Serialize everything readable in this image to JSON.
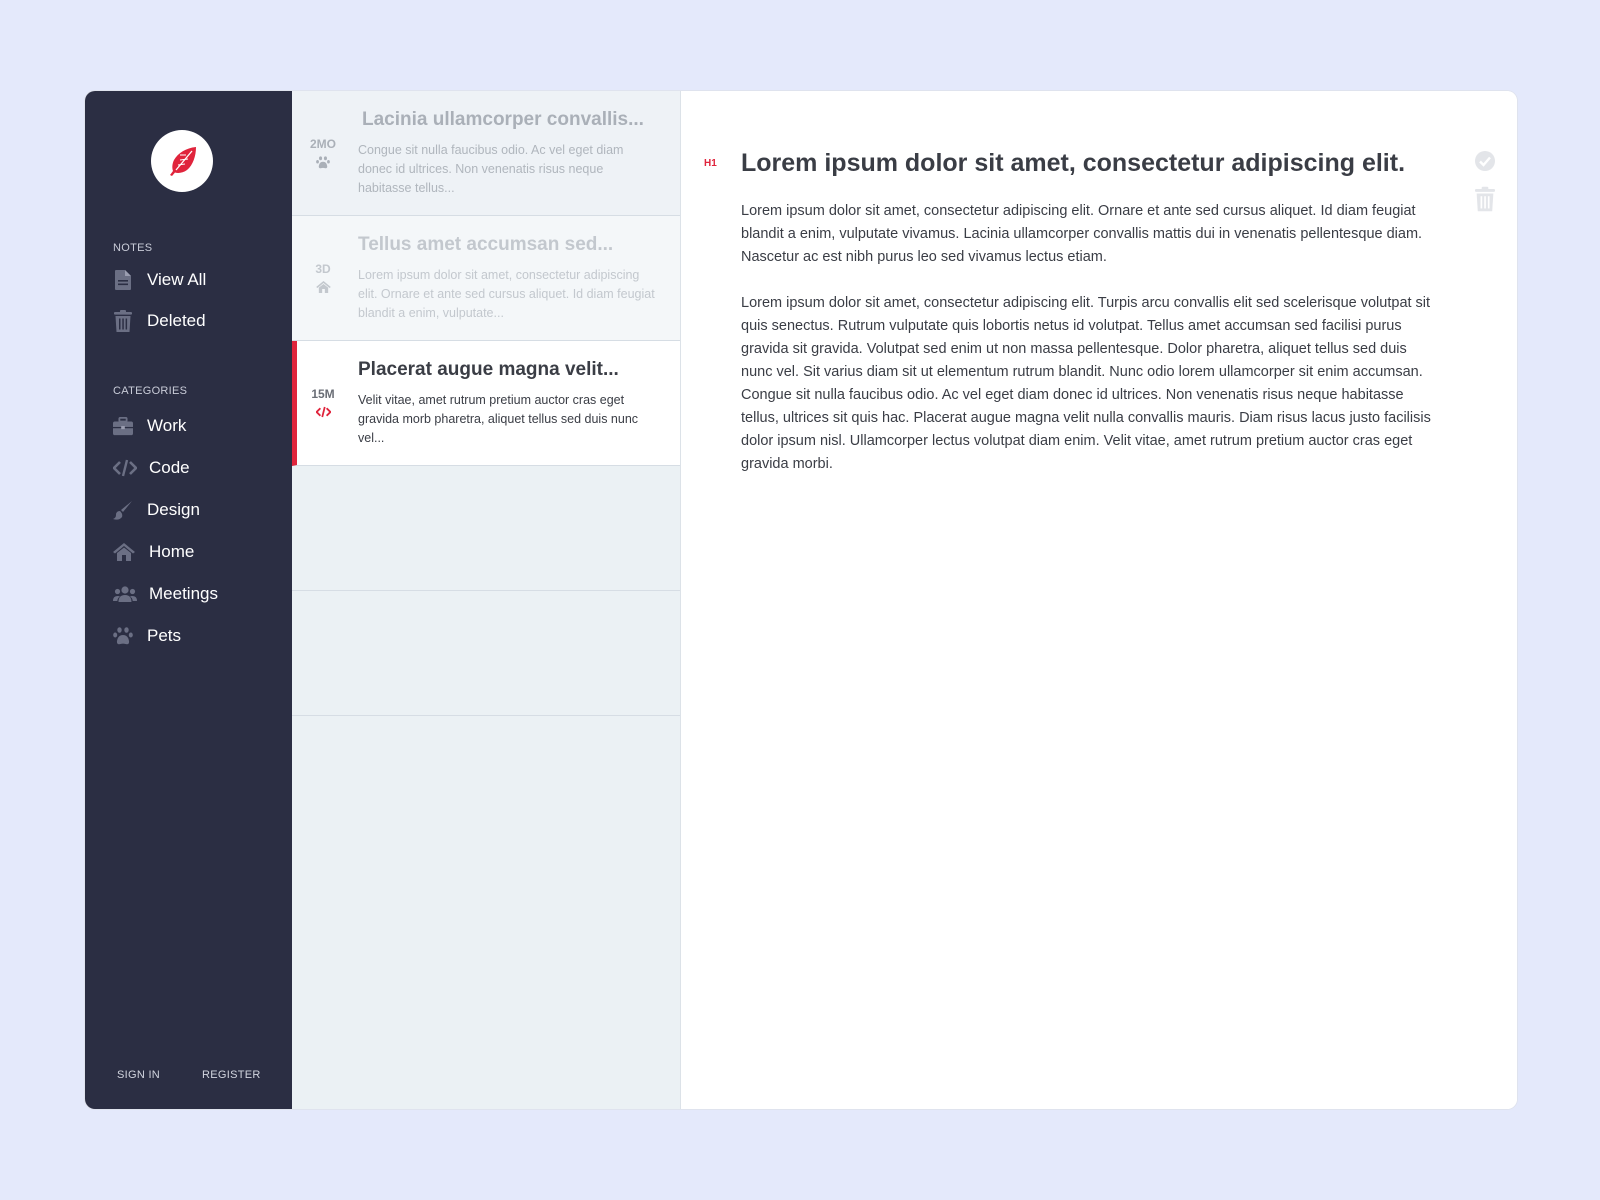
{
  "sidebar": {
    "logo_icon": "feather-icon",
    "notes_label": "NOTES",
    "notes_items": [
      {
        "label": "View All",
        "icon": "file-icon"
      },
      {
        "label": "Deleted",
        "icon": "trash-icon"
      }
    ],
    "categories_label": "CATEGORIES",
    "categories": [
      {
        "label": "Work",
        "icon": "briefcase-icon"
      },
      {
        "label": "Code",
        "icon": "code-icon"
      },
      {
        "label": "Design",
        "icon": "brush-icon"
      },
      {
        "label": "Home",
        "icon": "home-icon"
      },
      {
        "label": "Meetings",
        "icon": "users-icon"
      },
      {
        "label": "Pets",
        "icon": "paw-icon"
      }
    ],
    "sign_in": "SIGN IN",
    "register": "REGISTER"
  },
  "notes": [
    {
      "age": "2MO",
      "icon": "paw-icon",
      "title": "Lacinia ullamcorper convallis...",
      "excerpt": "Congue sit nulla faucibus odio. Ac vel eget diam donec id ultrices. Non venenatis risus neque habitasse tellus..."
    },
    {
      "age": "3D",
      "icon": "home-icon",
      "title": "Tellus amet accumsan sed...",
      "excerpt": "Lorem ipsum dolor sit amet, consectetur adipiscing elit. Ornare et ante sed cursus aliquet. Id diam feugiat blandit a enim, vulputate..."
    },
    {
      "age": "15M",
      "icon": "code-icon",
      "title": "Placerat augue magna velit...",
      "excerpt": "Velit vitae, amet rutrum pretium auctor cras eget gravida morb pharetra, aliquet tellus sed duis nunc vel..."
    }
  ],
  "editor": {
    "heading_tag": "H1",
    "title": "Lorem ipsum dolor sit amet, consectetur adipiscing elit.",
    "paragraphs": [
      "Lorem ipsum dolor sit amet, consectetur adipiscing elit. Ornare et ante sed cursus aliquet. Id diam feugiat blandit a enim, vulputate vivamus. Lacinia ullamcorper convallis mattis dui in venenatis pellentesque diam. Nascetur ac est nibh purus leo sed vivamus lectus etiam.",
      "Lorem ipsum dolor sit amet, consectetur adipiscing elit. Turpis arcu convallis elit sed scelerisque volutpat sit quis senectus. Rutrum vulputate quis lobortis netus id volutpat. Tellus amet accumsan sed facilisi purus gravida sit gravida. Volutpat sed enim ut non massa pellentesque. Dolor pharetra, aliquet tellus sed duis nunc vel. Sit varius diam sit ut elementum rutrum blandit. Nunc odio lorem ullamcorper sit enim accumsan. Congue sit nulla faucibus odio. Ac vel eget diam donec id ultrices. Non venenatis risus neque habitasse tellus, ultrices sit quis hac. Placerat augue magna velit nulla convallis mauris. Diam risus lacus justo facilisis dolor ipsum nisl. Ullamcorper lectus volutpat diam enim. Velit vitae, amet rutrum pretium auctor cras eget gravida morbi."
    ],
    "actions": [
      "check-circle-icon",
      "trash-icon"
    ]
  },
  "colors": {
    "accent": "#e0243c",
    "sidebar_bg": "#2b2e43",
    "page_bg": "#e4e9fb"
  }
}
